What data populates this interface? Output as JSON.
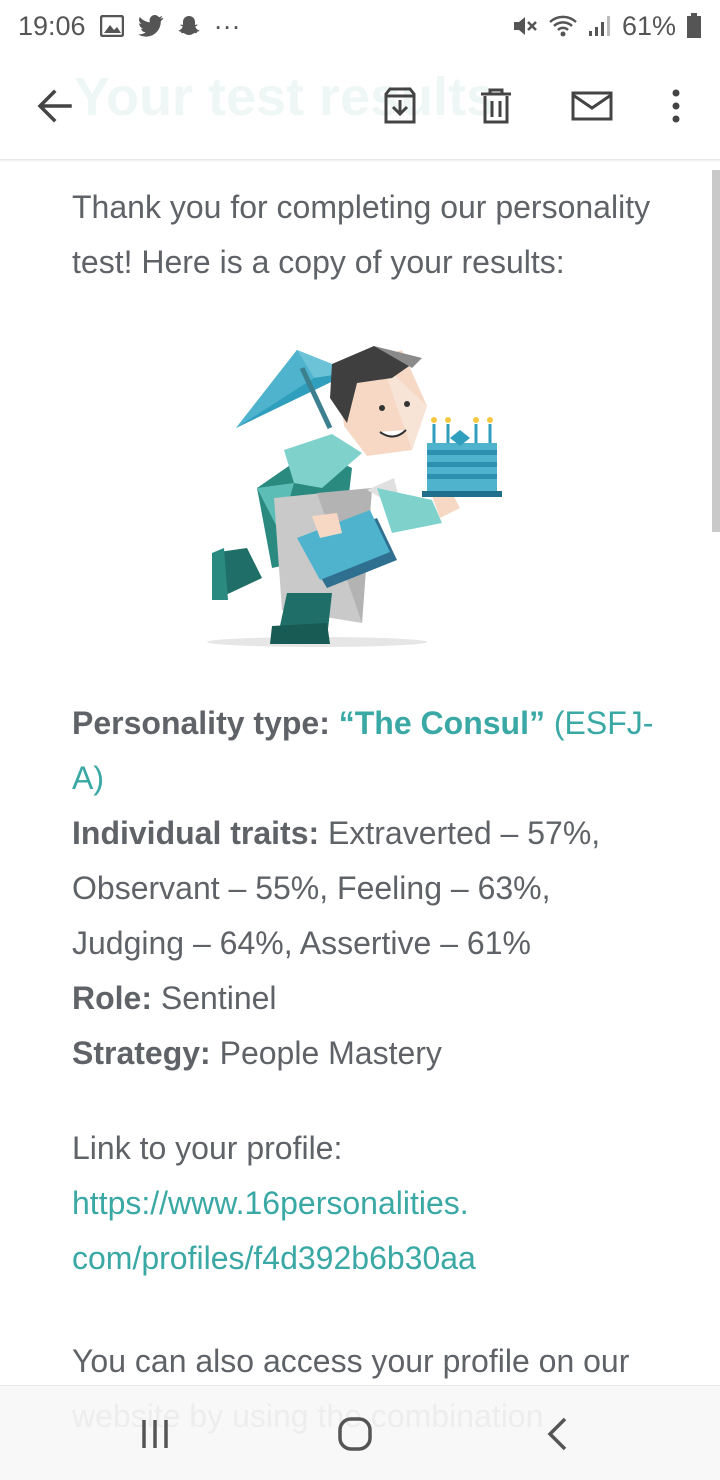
{
  "status_bar": {
    "time": "19:06",
    "more": "···",
    "battery": "61%",
    "icons": [
      "gallery-icon",
      "twitter-icon",
      "snapchat-icon",
      "mute-icon",
      "wifi-icon",
      "signal-icon",
      "battery-icon"
    ]
  },
  "app_bar": {
    "title": "Your test results",
    "icons": [
      "back-arrow-icon",
      "archive-icon",
      "trash-icon",
      "mail-icon",
      "more-vert-icon"
    ]
  },
  "email": {
    "intro": "Thank you for completing our personality test! Here is a copy of your results:",
    "personality_label": "Personality type:",
    "personality_name": "“The Consul”",
    "personality_code": "(ESFJ-A)",
    "traits_label": "Individual traits:",
    "traits_value": "Extraverted – 57%, Observant – 55%, Feeling – 63%, Judging – 64%, Assertive – 61%",
    "role_label": "Role:",
    "role_value": "Sentinel",
    "strategy_label": "Strategy:",
    "strategy_value": "People Mastery",
    "link_label": "Link to your profile:",
    "link_line1": "https://www.16personalities.",
    "link_line2": "com/profiles/f4d392b6b30aa",
    "followup": "You can also access your profile on our website by using the combination"
  },
  "colors": {
    "accent": "#3aa8a4",
    "text": "#5f6368",
    "faded_title": "#eef7f5"
  },
  "nav_bar": {
    "icons": [
      "recent-apps-icon",
      "home-icon",
      "back-icon"
    ]
  }
}
